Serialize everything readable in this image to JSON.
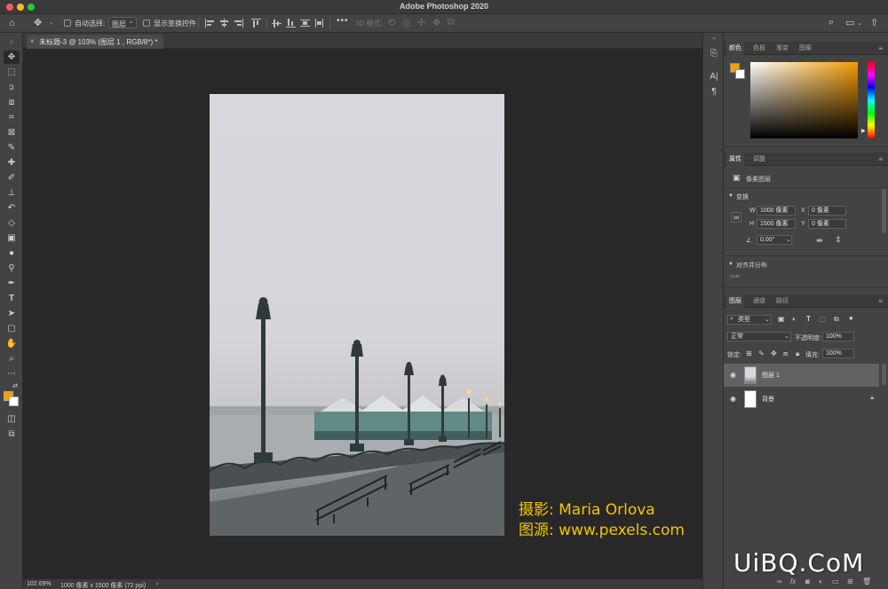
{
  "window": {
    "title": "Adobe Photoshop 2020"
  },
  "options_bar": {
    "auto_select_label": "自动选择:",
    "auto_select_value": "图层",
    "show_transform_label": "显示变换控件",
    "mode_3d_label": "3D 模式:",
    "more": "•••"
  },
  "document": {
    "tab_title": "未标题-3 @ 103% (图层 1 , RGB/8*) *",
    "close": "×"
  },
  "watermark": {
    "line1": "摄影: Maria Orlova",
    "line2": "图源: www.pexels.com"
  },
  "status_bar": {
    "zoom": "102.69%",
    "doc_info": "1000 像素 x 1500 像素 (72 ppi)",
    "arrow": "›"
  },
  "color_panel": {
    "tabs": [
      "颜色",
      "色板",
      "渐变",
      "图案"
    ],
    "active_tab": 0,
    "foreground": "#f5a000",
    "background": "#ffffff"
  },
  "properties_panel": {
    "tabs": [
      "属性",
      "调整"
    ],
    "active_tab": 0,
    "layer_type": "像素图层",
    "transform_header": "变换",
    "w_label": "W",
    "w_value": "1000 像素",
    "h_label": "H",
    "h_value": "1500 像素",
    "x_label": "X",
    "x_value": "0 像素",
    "y_label": "Y",
    "y_value": "0 像素",
    "angle_value": "0.00°",
    "align_header": "对齐并分布",
    "align_sub": "对齐:"
  },
  "layers_panel": {
    "tabs": [
      "图层",
      "通道",
      "路径"
    ],
    "active_tab": 0,
    "filter_label": "类型",
    "blend_mode": "正常",
    "opacity_label": "不透明度:",
    "opacity_value": "100%",
    "lock_label": "锁定:",
    "fill_label": "填充:",
    "fill_value": "100%",
    "layers": [
      {
        "name": "图层 1",
        "selected": true,
        "locked": false
      },
      {
        "name": "背景",
        "selected": false,
        "locked": true
      }
    ],
    "footer_icons": [
      "link-icon",
      "fx-icon",
      "mask-icon",
      "adjustment-icon",
      "folder-icon",
      "new-layer-icon",
      "trash-icon"
    ]
  },
  "site_mark": "UiBQ.CoM"
}
